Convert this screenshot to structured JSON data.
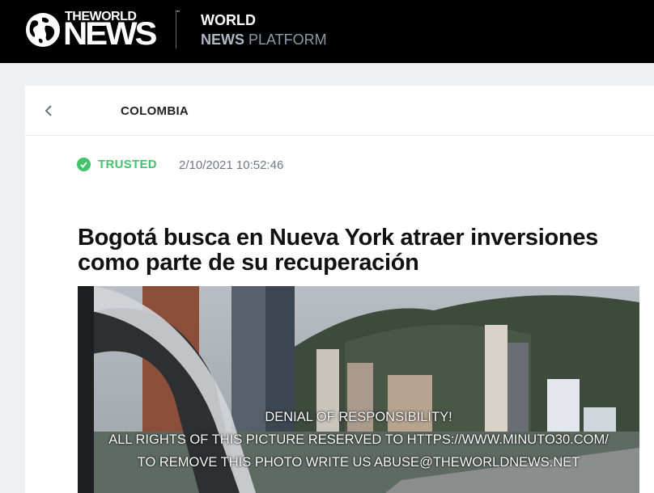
{
  "header": {
    "logo": {
      "the_world": "THEWORLD",
      "news": "NEWS",
      "tm": "™"
    },
    "platform": {
      "line1": "WORLD",
      "line2_bold": "NEWS",
      "line2_rest": " PLATFORM"
    }
  },
  "nav": {
    "back_icon": "chevron-left-icon",
    "section": "COLOMBIA"
  },
  "meta": {
    "badge": "TRUSTED",
    "timestamp": "2/10/2021 10:52:46"
  },
  "article": {
    "headline": "Bogotá busca en Nueva York atraer inversiones como parte de su recuperación",
    "image_disclaimer": [
      "DENIAL OF RESPONSIBILITY!",
      "ALL RIGHTS OF THIS PICTURE RESERVED TO HTTPS://WWW.MINUTO30.COM/",
      "TO REMOVE THIS PHOTO WRITE US ABUSE@THEWORLDNEWS.NET"
    ]
  },
  "colors": {
    "trusted": "#43c46c",
    "topbar": "#000000",
    "platform_grey": "#8e9aab"
  }
}
